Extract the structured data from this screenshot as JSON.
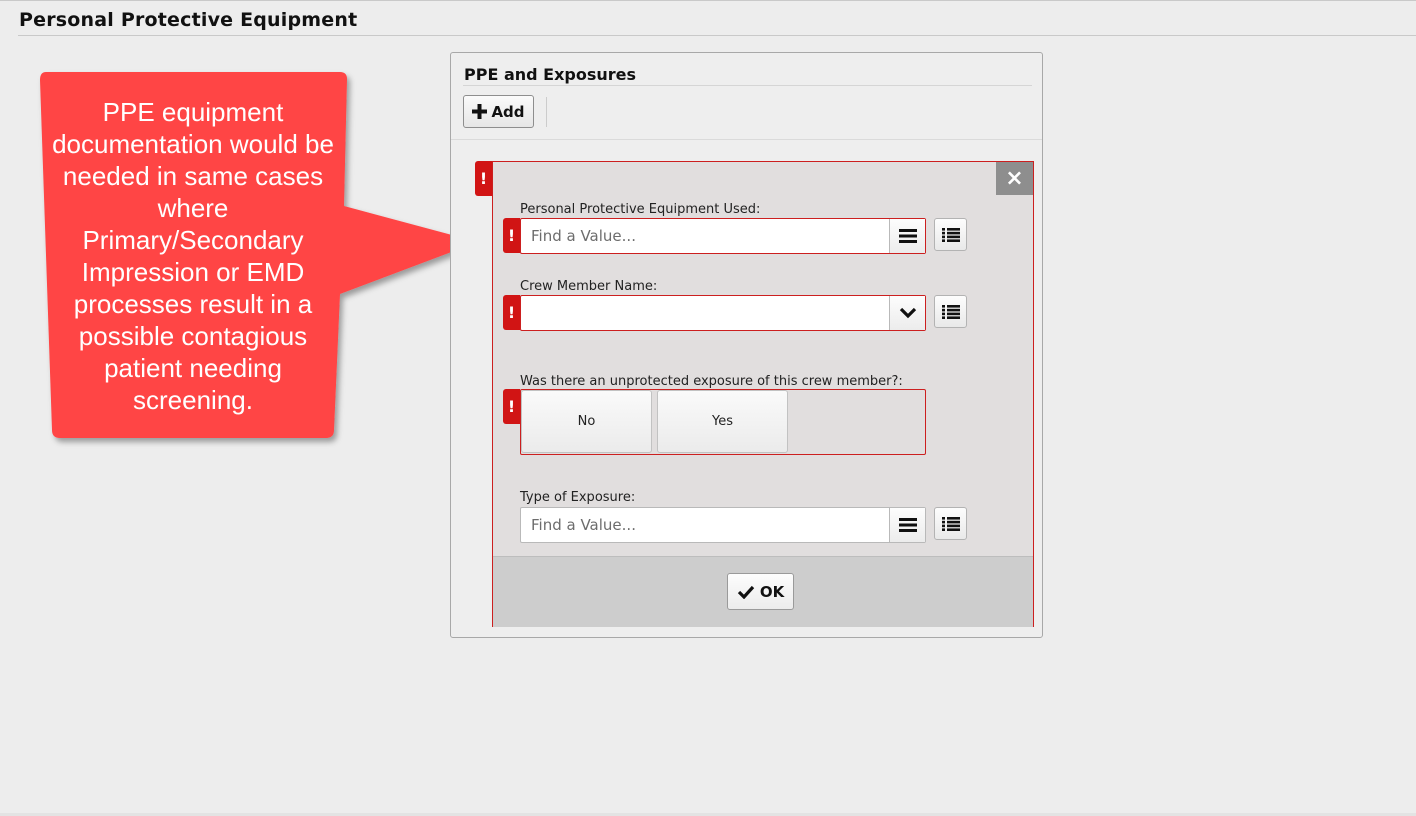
{
  "page": {
    "title": "Personal Protective Equipment"
  },
  "callout": {
    "text": "PPE equipment documentation would be needed in same cases where Primary/Secondary Impression or EMD processes result in a possible contagious patient needing screening.",
    "color": "#ff4444"
  },
  "panel": {
    "title": "PPE and Exposures",
    "add_label": "Add"
  },
  "form": {
    "error_mark": "!",
    "close_icon": "×",
    "fields": {
      "ppe_used": {
        "label": "Personal Protective Equipment Used:",
        "placeholder": "Find a Value...",
        "value": ""
      },
      "crew_member": {
        "label": "Crew Member Name:",
        "value": ""
      },
      "unprotected_exposure": {
        "label": "Was there an unprotected exposure of this crew member?:",
        "options": [
          "No",
          "Yes"
        ]
      },
      "exposure_type": {
        "label": "Type of Exposure:",
        "placeholder": "Find a Value...",
        "value": ""
      }
    },
    "ok_label": "OK"
  },
  "colors": {
    "error": "#d11414",
    "background": "#ededed",
    "card": "#e1dede"
  },
  "icons": [
    "plus-icon",
    "close-icon",
    "error-icon",
    "menu-icon",
    "list-icon",
    "chevron-down-icon",
    "check-icon"
  ]
}
